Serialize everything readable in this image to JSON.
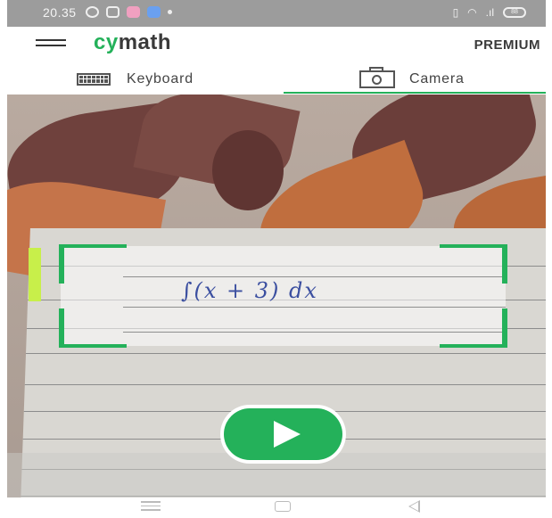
{
  "status_bar": {
    "time": "20.35",
    "icons": [
      "whatsapp-icon",
      "instagram-icon",
      "app-icon",
      "app-icon",
      "notification-dot-icon",
      "vibrate-icon",
      "wifi-icon",
      "signal-icon",
      "battery-icon"
    ],
    "battery": "88"
  },
  "header": {
    "logo_cy": "cy",
    "logo_rest": "math",
    "premium_label": "PREMIUM"
  },
  "tabs": {
    "keyboard_label": "Keyboard",
    "camera_label": "Camera",
    "active": "Camera"
  },
  "camera": {
    "handwritten_text": "∫(x + 3) dx"
  },
  "colors": {
    "accent": "#24b15a",
    "text": "#3a3a3a"
  }
}
